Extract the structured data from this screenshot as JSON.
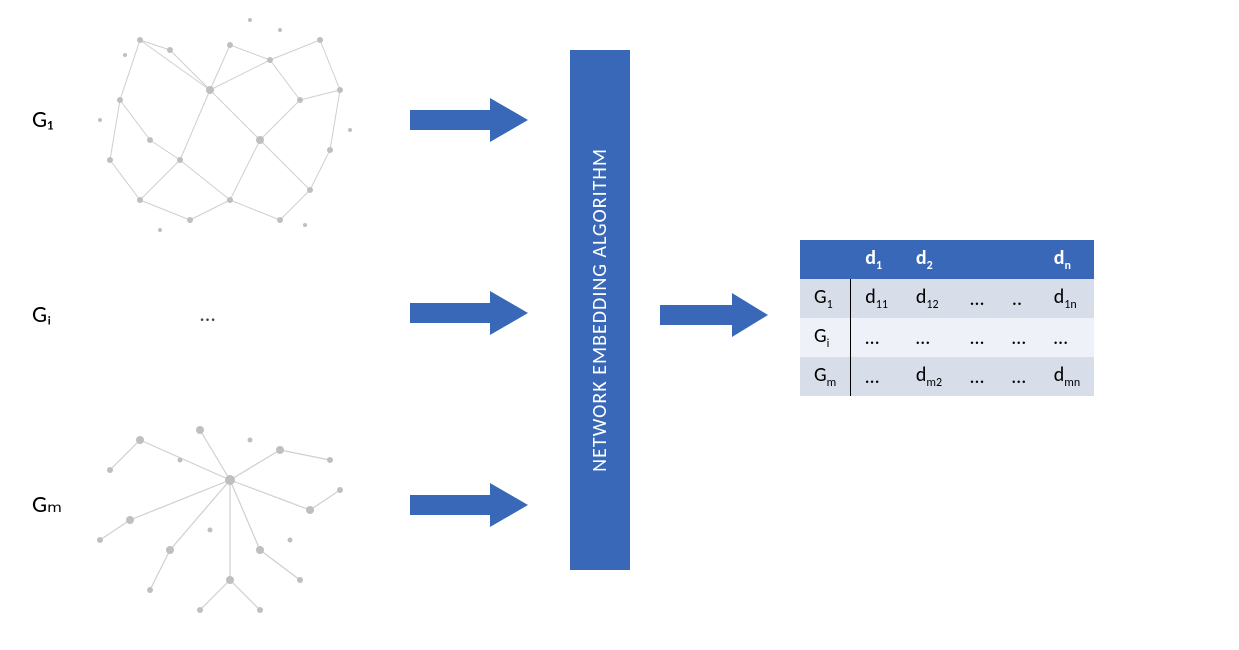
{
  "labels": {
    "g1": "G₁",
    "gi": "Gᵢ",
    "gm": "Gₘ",
    "center_placeholder": "…"
  },
  "algorithm": {
    "label": "NETWORK EMBEDDING ALGORITHM"
  },
  "colors": {
    "brand_blue": "#3868b7",
    "graph_gray": "#c2c2c2",
    "row_alt_a": "#d7dde9",
    "row_alt_b": "#eef2f8"
  },
  "icons": {
    "arrow": "arrow-right-icon",
    "graph": "network-graph-icon",
    "algo": "algorithm-block"
  },
  "table": {
    "header": {
      "c0": "",
      "c1_main": "d",
      "c1_sub": "1",
      "c2_main": "d",
      "c2_sub": "2",
      "c3": "",
      "c4": "",
      "c5_main": "d",
      "c5_sub": "n"
    },
    "rows": [
      {
        "c0_main": "G",
        "c0_sub": "1",
        "c1_main": "d",
        "c1_sub": "11",
        "c2_main": "d",
        "c2_sub": "12",
        "c3": "…",
        "c4": "..",
        "c5_main": "d",
        "c5_sub": "1n"
      },
      {
        "c0_main": "G",
        "c0_sub": "i",
        "c1": "…",
        "c2": "…",
        "c3": "…",
        "c4": "…",
        "c5": "…"
      },
      {
        "c0_main": "G",
        "c0_sub": "m",
        "c1": "…",
        "c2_main": "d",
        "c2_sub": "m2",
        "c3": "…",
        "c4": "…",
        "c5_main": "d",
        "c5_sub": "mn"
      }
    ]
  }
}
